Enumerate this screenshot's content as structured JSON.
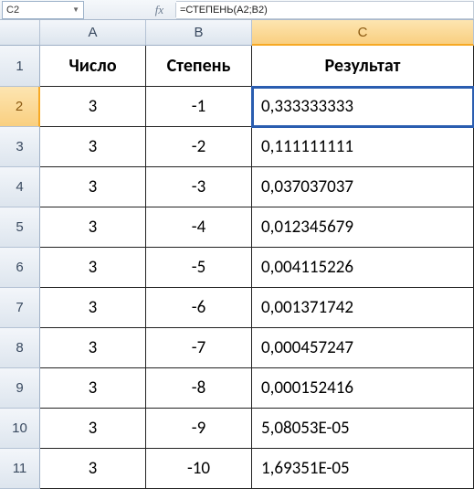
{
  "name_box": "C2",
  "fx_label": "fx",
  "formula": "=СТЕПЕНЬ(A2;B2)",
  "columns": [
    "A",
    "B",
    "C"
  ],
  "headers": {
    "A": "Число",
    "B": "Степень",
    "C": "Результат"
  },
  "active_cell": {
    "row": 2,
    "col": "C"
  },
  "chart_data": {
    "type": "table",
    "title": "Результат функции СТЕПЕНЬ",
    "rows": [
      {
        "n": 1,
        "A": "Число",
        "B": "Степень",
        "C": "Результат",
        "header": true
      },
      {
        "n": 2,
        "A": "3",
        "B": "-1",
        "C": "0,333333333"
      },
      {
        "n": 3,
        "A": "3",
        "B": "-2",
        "C": "0,111111111"
      },
      {
        "n": 4,
        "A": "3",
        "B": "-3",
        "C": "0,037037037"
      },
      {
        "n": 5,
        "A": "3",
        "B": "-4",
        "C": "0,012345679"
      },
      {
        "n": 6,
        "A": "3",
        "B": "-5",
        "C": "0,004115226"
      },
      {
        "n": 7,
        "A": "3",
        "B": "-6",
        "C": "0,001371742"
      },
      {
        "n": 8,
        "A": "3",
        "B": "-7",
        "C": "0,000457247"
      },
      {
        "n": 9,
        "A": "3",
        "B": "-8",
        "C": "0,000152416"
      },
      {
        "n": 10,
        "A": "3",
        "B": "-9",
        "C": "5,08053E-05"
      },
      {
        "n": 11,
        "A": "3",
        "B": "-10",
        "C": "1,69351E-05"
      }
    ]
  }
}
